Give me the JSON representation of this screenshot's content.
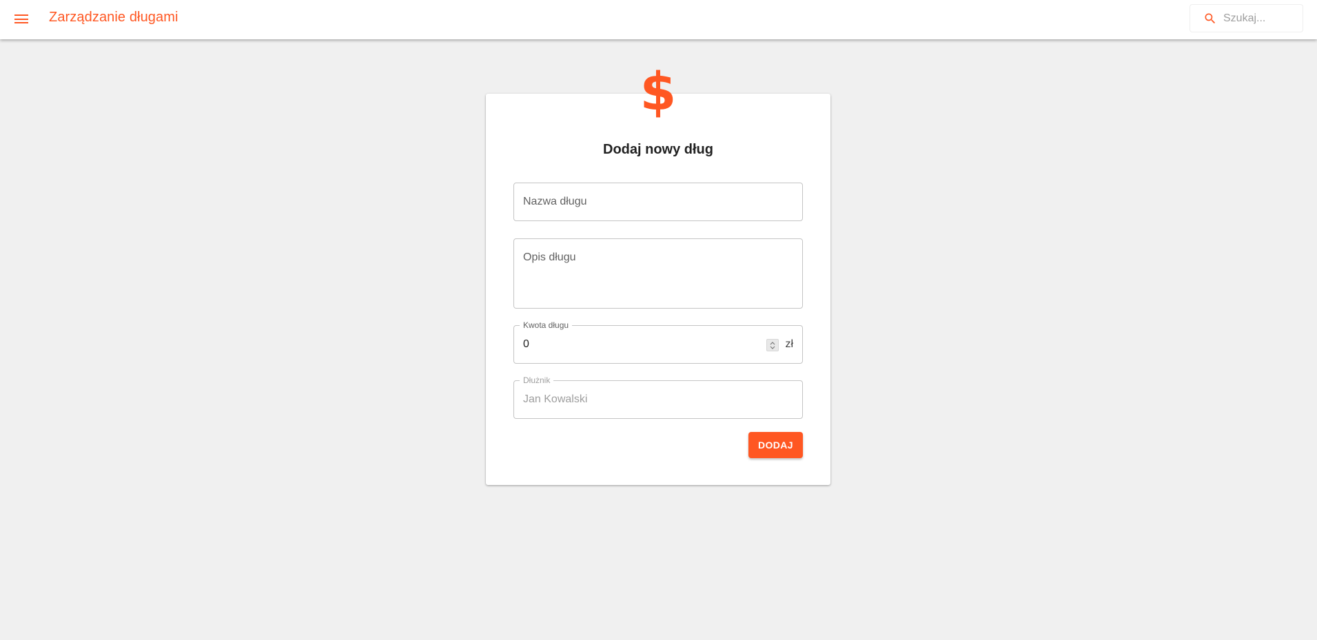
{
  "appbar": {
    "title": "Zarządzanie długami",
    "menu_icon": "menu-icon",
    "search": {
      "icon": "search-icon",
      "placeholder": "Szukaj..."
    }
  },
  "form": {
    "icon": "dollar-icon",
    "icon_glyph": "$",
    "title": "Dodaj nowy dług",
    "fields": {
      "name": {
        "placeholder": "Nazwa długu"
      },
      "description": {
        "placeholder": "Opis długu"
      },
      "amount": {
        "label": "Kwota długu",
        "value": "0",
        "unit": "zł"
      },
      "debtor": {
        "label": "Dłużnik",
        "placeholder": "Jan Kowalski"
      }
    },
    "submit_label": "DODAJ"
  },
  "colors": {
    "accent": "#ff5722",
    "background": "#f0f0f0",
    "surface": "#ffffff"
  }
}
